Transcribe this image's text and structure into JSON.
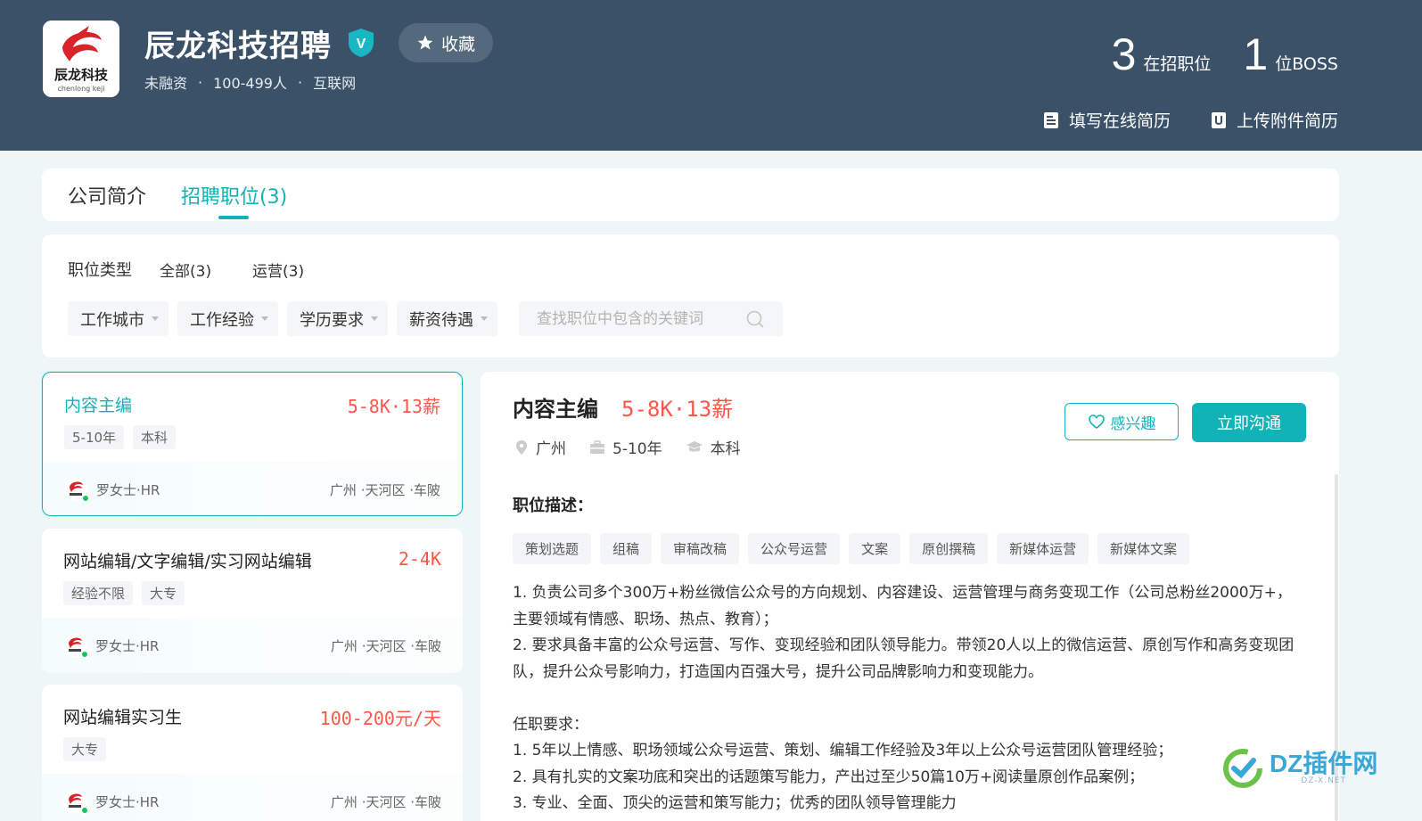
{
  "company": {
    "name": "辰龙科技招聘",
    "logo_text": "辰龙科技",
    "logo_sub": "chenlong keji",
    "verified_mark": "V",
    "favorite_label": "收藏",
    "meta": [
      "未融资",
      "100-499人",
      "互联网"
    ],
    "meta_sep": "·"
  },
  "stats": {
    "jobs_count": "3",
    "jobs_label": "在招职位",
    "boss_count": "1",
    "boss_label": "位BOSS"
  },
  "resume_actions": {
    "online": "填写在线简历",
    "upload": "上传附件简历"
  },
  "tabs": [
    {
      "label": "公司简介",
      "active": false
    },
    {
      "label": "招聘职位(3)",
      "active": true
    }
  ],
  "filters": {
    "type_label": "职位类型",
    "types": [
      "全部(3)",
      "运营(3)"
    ],
    "dropdowns": [
      "工作城市",
      "工作经验",
      "学历要求",
      "薪资待遇"
    ],
    "search_placeholder": "查找职位中包含的关键词"
  },
  "jobs": [
    {
      "title": "内容主编",
      "salary": "5-8K·13薪",
      "tags": [
        "5-10年",
        "本科"
      ],
      "hr": "罗女士·HR",
      "location": "广州 ·天河区 ·车陂",
      "active": true
    },
    {
      "title": "网站编辑/文字编辑/实习网站编辑",
      "salary": "2-4K",
      "tags": [
        "经验不限",
        "大专"
      ],
      "hr": "罗女士·HR",
      "location": "广州 ·天河区 ·车陂",
      "active": false
    },
    {
      "title": "网站编辑实习生",
      "salary": "100-200元/天",
      "tags": [
        "大专"
      ],
      "hr": "罗女士·HR",
      "location": "广州 ·天河区 ·车陂",
      "active": false
    }
  ],
  "detail": {
    "title": "内容主编",
    "salary": "5-8K·13薪",
    "city": "广州",
    "experience": "5-10年",
    "degree": "本科",
    "like_label": "感兴趣",
    "chat_label": "立即沟通",
    "section_title": "职位描述：",
    "tags": [
      "策划选题",
      "组稿",
      "审稿改稿",
      "公众号运营",
      "文案",
      "原创撰稿",
      "新媒体运营",
      "新媒体文案"
    ],
    "description": "1. 负责公司多个300万+粉丝微信公众号的方向规划、内容建设、运营管理与商务变现工作（公司总粉丝2000万+，主要领域有情感、职场、热点、教育）；\n2. 要求具备丰富的公众号运营、写作、变现经验和团队领导能力。带领20人以上的微信运营、原创写作和高务变现团队，提升公众号影响力，打造国内百强大号，提升公司品牌影响力和变现能力。\n\n任职要求：\n1. 5年以上情感、职场领域公众号运营、策划、编辑工作经验及3年以上公众号运营团队管理经验；\n2. 具有扎实的文案功底和突出的话题策写能力，产出过至少50篇10万+阅读量原创作品案例；\n3. 专业、全面、顶尖的运营和策写能力；优秀的团队领导管理能力"
  },
  "watermark": {
    "text": "DZ插件网",
    "sub": "DZ-X.NET"
  },
  "colors": {
    "header_bg": "#3a5168",
    "accent": "#12b3b8",
    "salary": "#fe574a",
    "page_bg": "#eef6f8"
  }
}
